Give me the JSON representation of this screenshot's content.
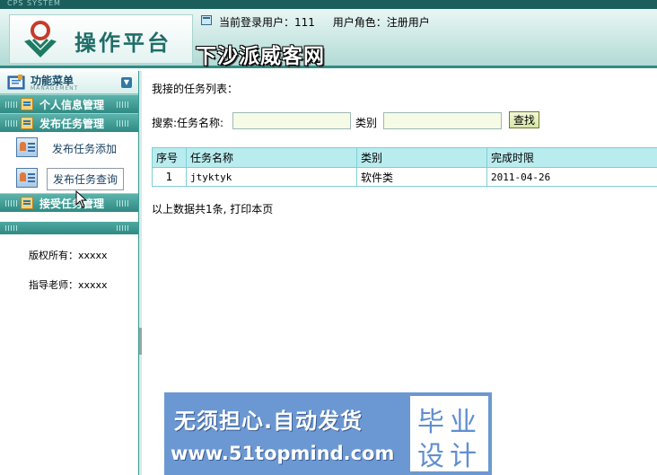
{
  "header": {
    "strip_text": "CPS SYSTEM",
    "logo_title": "操作平台",
    "current_user_label": "当前登录用户：",
    "current_user": "111",
    "role_label": "用户角色：",
    "role": "注册用户",
    "overlay_text": "下沙派威客网"
  },
  "sidebar": {
    "menu_title": "功能菜单",
    "menu_subtitle": "MANAGEMENT",
    "sections": [
      {
        "label": "个人信息管理"
      },
      {
        "label": "发布任务管理"
      },
      {
        "label": "接受任务管理"
      }
    ],
    "items": [
      {
        "label": "发布任务添加"
      },
      {
        "label": "发布任务查询"
      }
    ],
    "copyright_label": "版权所有：",
    "copyright_value": "xxxxx",
    "advisor_label": "指导老师：",
    "advisor_value": "xxxxx"
  },
  "main": {
    "title": "我接的任务列表：",
    "search": {
      "label": "搜索:任务名称:",
      "name_value": "",
      "category_label": "类别",
      "category_value": "",
      "button": "查找"
    },
    "table": {
      "headers": [
        "序号",
        "任务名称",
        "类别",
        "完成时限"
      ],
      "rows": [
        [
          "1",
          "jtyktyk",
          "软件类",
          "2011-04-26"
        ]
      ]
    },
    "summary": "以上数据共1条, 打印本页"
  },
  "banner": {
    "line1": "无须担心.自动发货",
    "line2": "www.51topmind.com",
    "right_top": "毕业",
    "right_bottom": "设计"
  },
  "colors": {
    "accent": "#2f8a83",
    "table_header": "#b9ecef",
    "banner": "#6b98d3"
  }
}
